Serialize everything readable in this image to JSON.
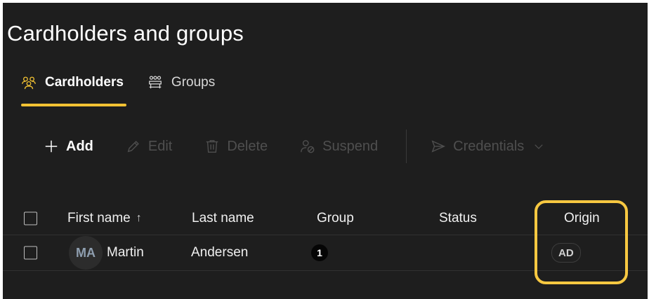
{
  "page": {
    "title": "Cardholders and groups"
  },
  "tabs": [
    {
      "label": "Cardholders",
      "icon": "cardholders-icon",
      "active": true
    },
    {
      "label": "Groups",
      "icon": "groups-icon",
      "active": false
    }
  ],
  "toolbar": {
    "add": "Add",
    "edit": "Edit",
    "delete": "Delete",
    "suspend": "Suspend",
    "credentials": "Credentials"
  },
  "table": {
    "columns": {
      "first_name": "First name",
      "last_name": "Last name",
      "group": "Group",
      "status": "Status",
      "origin": "Origin"
    },
    "sort_indicator": "↑",
    "rows": [
      {
        "initials": "MA",
        "first_name": "Martin",
        "last_name": "Andersen",
        "group_count": "1",
        "status": "",
        "origin": "AD"
      }
    ]
  },
  "colors": {
    "background": "#1e1e1e",
    "accent": "#f2c233",
    "highlight": "#f7c841",
    "disabled_text": "#4f4f4f"
  }
}
